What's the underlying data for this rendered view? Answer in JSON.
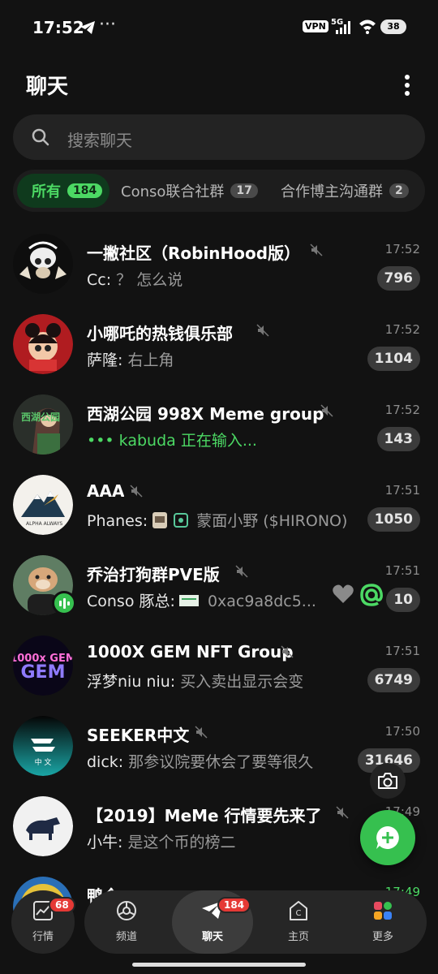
{
  "status": {
    "time": "17:52",
    "dots": "···",
    "vpn": "VPN",
    "net": "5G",
    "battery": "38"
  },
  "header": {
    "title": "聊天"
  },
  "search": {
    "placeholder": "搜索聊天"
  },
  "tabs": [
    {
      "label": "所有",
      "count": "184"
    },
    {
      "label": "Conso联合社群",
      "count": "17"
    },
    {
      "label": "合作博主沟通群",
      "count": "2"
    }
  ],
  "chats": [
    {
      "name": "一撇社区（RobinHood版）",
      "time": "17:52",
      "sender": "Cc:",
      "text": " ？ 怎么说",
      "badge": "796"
    },
    {
      "name": "小哪吒的热钱俱乐部",
      "time": "17:52",
      "sender": "萨隆:",
      "text": " 右上角",
      "badge": "1104"
    },
    {
      "name": "西湖公园 998X Meme group",
      "time": "17:52",
      "sender": "",
      "text": "••• kabuda 正在输入...",
      "badge": "143",
      "avatar_text": "西湖公园"
    },
    {
      "name": "AAA",
      "time": "17:51",
      "sender": "Phanes:",
      "text": " 蒙面小野 ($HIRONO)",
      "badge": "1050",
      "avatar_text": "ALPHA ALWAYS"
    },
    {
      "name": "乔治打狗群PVE版",
      "time": "17:51",
      "sender": "Conso 豚总:",
      "text": " 0xac9a8dc5...",
      "badge": "10"
    },
    {
      "name": "1000X GEM NFT Group",
      "time": "17:51",
      "sender": "浮梦niu niu:",
      "text": " 买入卖出显示会变",
      "badge": "6749",
      "avatar_text": "1000x GEM"
    },
    {
      "name": "SEEKER中文",
      "time": "17:50",
      "sender": "dick:",
      "text": " 那参议院要休会了要等很久",
      "badge": "31646",
      "avatar_text": "中 文"
    },
    {
      "name": "【2019】MeMe 行情要先来了",
      "time": "17:49",
      "sender": "小牛:",
      "text": " 是这个币的榜二",
      "badge": ""
    },
    {
      "name": "鸭全",
      "time": "17:49",
      "sender": "",
      "text": "",
      "badge": ""
    }
  ],
  "nav": {
    "market": {
      "label": "行情",
      "badge": "68"
    },
    "channels": {
      "label": "频道"
    },
    "chats": {
      "label": "聊天",
      "badge": "184"
    },
    "home": {
      "label": "主页"
    },
    "more": {
      "label": "更多"
    }
  },
  "colors": {
    "accent": "#4cd964",
    "background": "#121212",
    "badge_red": "#e53935"
  }
}
